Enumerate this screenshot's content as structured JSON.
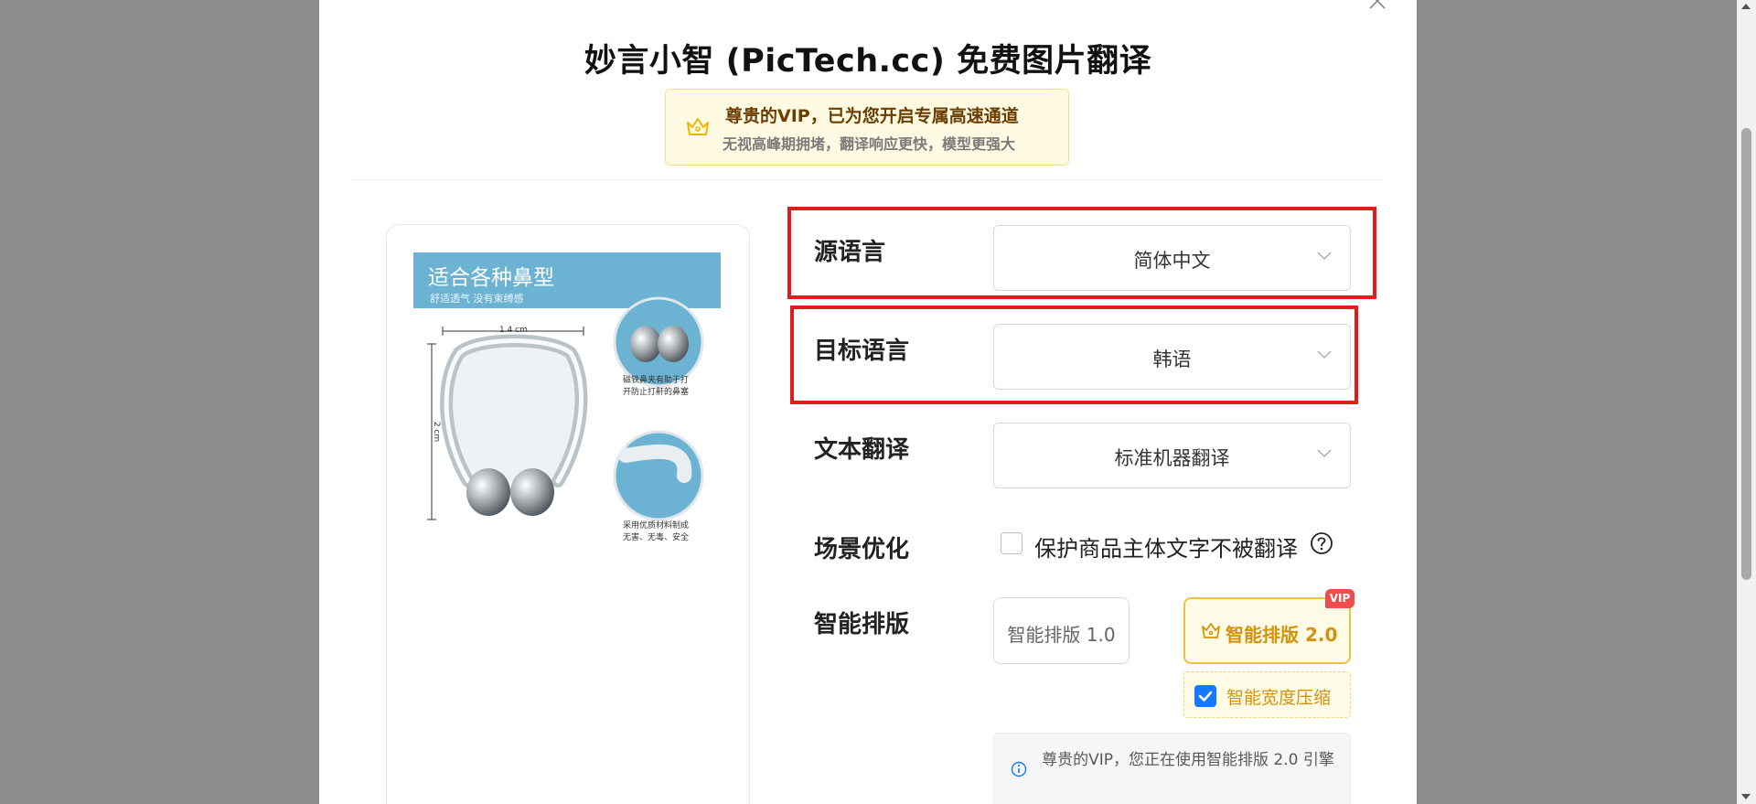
{
  "modal": {
    "title": "妙言小智 (PicTech.cc) 免费图片翻译"
  },
  "vip_banner": {
    "line1": "尊贵的VIP，已为您开启专属高速通道",
    "line2": "无视高峰期拥堵，翻译响应更快，模型更强大",
    "icon": "crown-icon",
    "accent_color": "#6b3d00"
  },
  "product_image": {
    "headline": "适合各种鼻型",
    "subline": "舒适透气 没有束缚感",
    "width_label": "1.4 cm",
    "height_label": "2 cm",
    "caption1": [
      "磁铁鼻夹有助于打",
      "开防止打鼾的鼻塞"
    ],
    "caption2": [
      "采用优质材料制成",
      "无害、无毒、安全"
    ]
  },
  "form": {
    "source_language": {
      "label": "源语言",
      "value": "简体中文"
    },
    "target_language": {
      "label": "目标语言",
      "value": "韩语"
    },
    "text_translation": {
      "label": "文本翻译",
      "value": "标准机器翻译"
    },
    "scene_optimization": {
      "label": "场景优化",
      "checkbox_label": "保护商品主体文字不被翻译",
      "checked": false
    },
    "smart_layout": {
      "label": "智能排版",
      "option_v1": "智能排版 1.0",
      "option_v2": "智能排版 2.0",
      "vip_tag": "VIP",
      "selected": "智能排版 2.0",
      "compress_label": "智能宽度压缩",
      "compress_checked": true
    },
    "info": "尊贵的VIP，您正在使用智能排版 2.0 引擎"
  },
  "colors": {
    "highlight_red": "#e01c1c",
    "vip_gold": "#d4920b",
    "checkbox_blue": "#1677ff",
    "overlay_gray": "#8c8c8c"
  }
}
